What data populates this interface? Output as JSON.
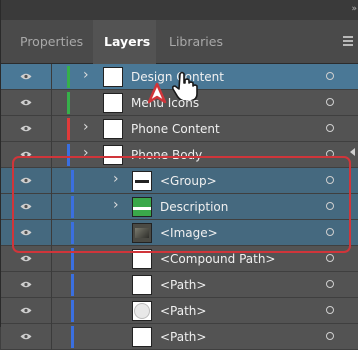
{
  "panel": {
    "collapse_glyph": "»",
    "tabs": [
      {
        "label": "Properties",
        "active": false
      },
      {
        "label": "Layers",
        "active": true
      },
      {
        "label": "Libraries",
        "active": false
      }
    ],
    "menu_icon": "hamburger-menu-icon"
  },
  "layers": [
    {
      "label": "Design Content",
      "color": "#36b04a",
      "expanded": true,
      "selected": true,
      "thumb": "white"
    },
    {
      "label": "Menu Icons",
      "color": "#36b04a",
      "expanded": false,
      "selected": false,
      "thumb": "white"
    },
    {
      "label": "Phone Content",
      "color": "#e03a3a",
      "expanded": true,
      "selected": false,
      "thumb": "white"
    },
    {
      "label": "Phone Body",
      "color": "#3a6fe0",
      "expanded": true,
      "selected": false,
      "thumb": "white"
    },
    {
      "label": "<Group>",
      "color": "#3a6fe0",
      "expanded": true,
      "selected": true,
      "thumb": "group"
    },
    {
      "label": "Description",
      "color": "#3a6fe0",
      "expanded": true,
      "selected": true,
      "thumb": "green"
    },
    {
      "label": "<Image>",
      "color": "#3a6fe0",
      "expanded": false,
      "selected": true,
      "thumb": "photo"
    },
    {
      "label": "<Compound Path>",
      "color": "#3a6fe0",
      "expanded": false,
      "selected": false,
      "thumb": "white"
    },
    {
      "label": "<Path>",
      "color": "#3a6fe0",
      "expanded": false,
      "selected": false,
      "thumb": "white"
    },
    {
      "label": "<Path>",
      "color": "#3a6fe0",
      "expanded": false,
      "selected": false,
      "thumb": "circle"
    },
    {
      "label": "<Path>",
      "color": "#3a6fe0",
      "expanded": false,
      "selected": false,
      "thumb": "white"
    }
  ],
  "colors": {
    "callout": "#d0353a",
    "selection": "#45697f",
    "row": "#535353"
  }
}
